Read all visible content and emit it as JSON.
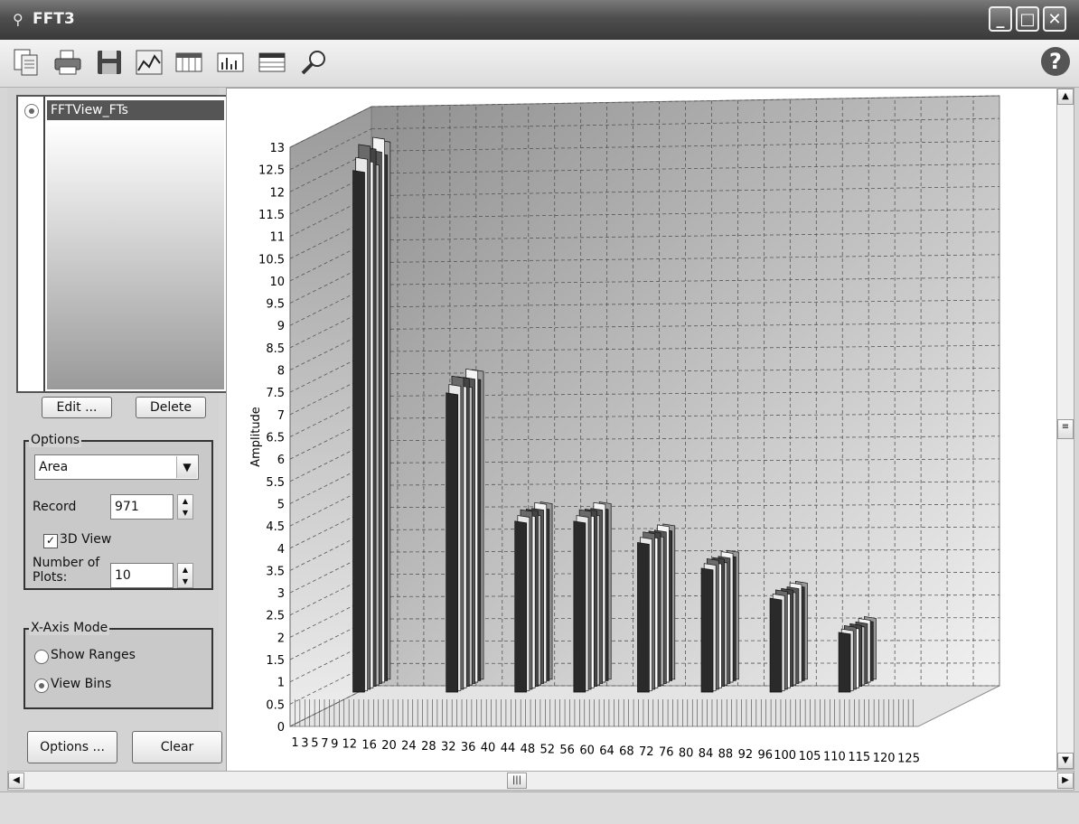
{
  "window": {
    "title": "FFT3"
  },
  "titlebar_buttons": {
    "minimize": "_",
    "maximize": "□",
    "close": "✕"
  },
  "toolbar": {
    "tools": [
      "copy-icon",
      "print-icon",
      "save-icon",
      "chart-icon",
      "table-icon",
      "spectrum-icon",
      "grid-icon",
      "zoom-icon"
    ],
    "help": "?"
  },
  "plots_list": {
    "items": [
      "FFTView_FTs"
    ],
    "edit_label": "Edit ...",
    "delete_label": "Delete"
  },
  "options": {
    "legend": "Options",
    "plot_type": "Area",
    "record_label": "Record",
    "record_value": "971",
    "view3d_label": "3D View",
    "view3d_checked": true,
    "num_plots_label_1": "Number of",
    "num_plots_label_2": "Plots:",
    "num_plots_value": "10"
  },
  "xaxis_mode": {
    "legend": "X-Axis Mode",
    "show_ranges": "Show Ranges",
    "view_bins": "View Bins",
    "selected": "View Bins"
  },
  "bottom_buttons": {
    "options_label": "Options ...",
    "clear_label": "Clear"
  },
  "chart_data": {
    "type": "area",
    "ylabel": "Amplitude",
    "y_ticks": [
      "0",
      "0.5",
      "1",
      "1.5",
      "2",
      "2.5",
      "3",
      "3.5",
      "4",
      "4.5",
      "5",
      "5.5",
      "6",
      "6.5",
      "7",
      "7.5",
      "8",
      "8.5",
      "9",
      "9.5",
      "10",
      "10.5",
      "11",
      "11.5",
      "12",
      "12.5",
      "13"
    ],
    "x_tick_labels": [
      "1",
      "3",
      "5",
      "7",
      "9",
      "12",
      "16",
      "20",
      "24",
      "28",
      "32",
      "36",
      "40",
      "44",
      "48",
      "52",
      "56",
      "60",
      "64",
      "68",
      "72",
      "76",
      "80",
      "84",
      "88",
      "92",
      "96",
      "100",
      "105",
      "110",
      "115",
      "120",
      "125"
    ],
    "ylim": [
      0,
      13
    ],
    "view_3d": true,
    "plots": 10,
    "peaks": [
      {
        "bin": 14,
        "amplitude": 13.0
      },
      {
        "bin": 33,
        "amplitude": 7.8
      },
      {
        "bin": 47,
        "amplitude": 4.8
      },
      {
        "bin": 59,
        "amplitude": 4.8
      },
      {
        "bin": 72,
        "amplitude": 4.3
      },
      {
        "bin": 85,
        "amplitude": 3.7
      },
      {
        "bin": 99,
        "amplitude": 3.0
      },
      {
        "bin": 113,
        "amplitude": 2.2
      }
    ]
  }
}
